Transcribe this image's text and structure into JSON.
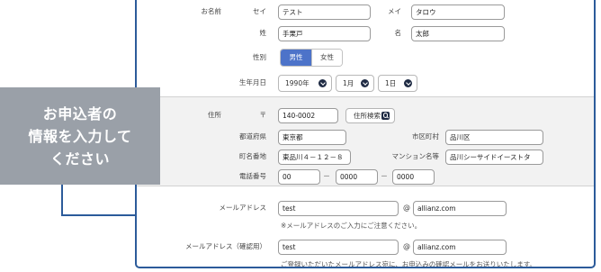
{
  "name_section": {
    "name_label": "お名前",
    "sei_label": "セイ",
    "sei_value": "テスト",
    "mei_label": "メイ",
    "mei_value": "タロウ",
    "last_label": "姓",
    "last_value": "手栗戸",
    "first_label": "名",
    "first_value": "太郎",
    "gender_label": "性別",
    "gender_male": "男性",
    "gender_female": "女性",
    "gender_selected": "男性",
    "birth_label": "生年月日",
    "birth_year": "1990年",
    "birth_month": "1月",
    "birth_day": "1日"
  },
  "address_section": {
    "address_label": "住所",
    "postal_mark": "〒",
    "postal_value": "140-0002",
    "search_button": "住所検索",
    "prefecture_label": "都道府県",
    "prefecture_value": "東京都",
    "city_label": "市区町村",
    "city_value": "品川区",
    "street_label": "町名番地",
    "street_value": "東品川４－１２－８",
    "building_label": "マンション名等",
    "building_value": "品川シーサイドイーストタ",
    "phone_label": "電話番号",
    "phone_1": "00",
    "phone_2": "0000",
    "phone_3": "0000",
    "phone_sep": "－"
  },
  "email_section": {
    "email_label": "メールアドレス",
    "email_local": "test",
    "at_mark": "@",
    "email_domain": "allianz.com",
    "email_note": "※メールアドレスのご入力にご注意ください。",
    "confirm_label": "メールアドレス（確認用）",
    "confirm_local": "test",
    "confirm_domain": "allianz.com",
    "confirm_note": "ご登録いただいたメールアドレス宛に、お申込みの確認メールをお送りいたします。"
  },
  "callout": {
    "line1": "お申込者の",
    "line2": "情報を入力して",
    "line3": "ください"
  },
  "colors": {
    "frame_border": "#2c5b9a",
    "selected_toggle": "#4d73c9",
    "callout_bg": "#9aa0a8",
    "address_band": "#f2f2f2"
  }
}
